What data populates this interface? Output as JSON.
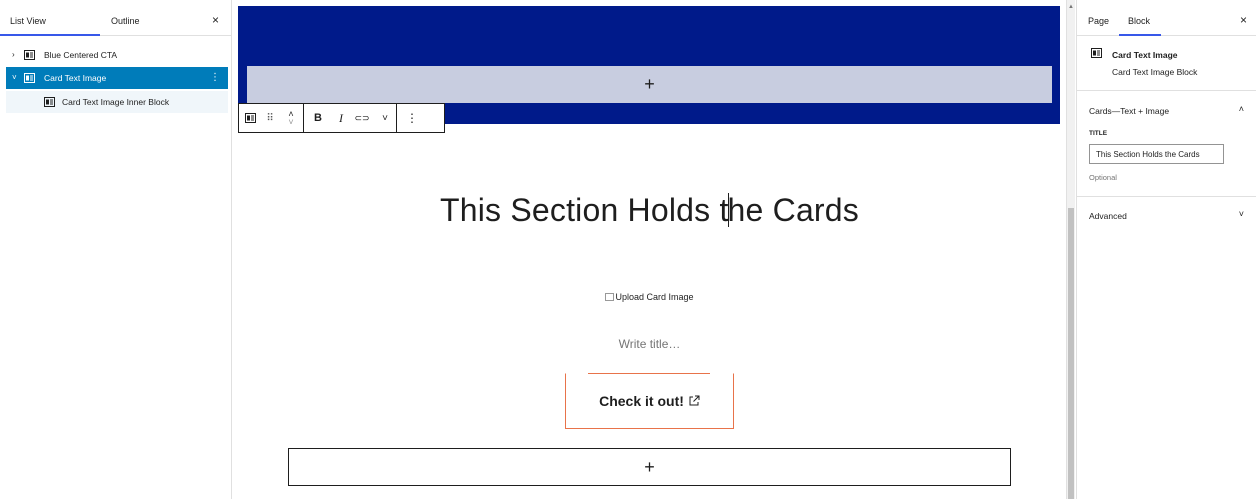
{
  "left_sidebar": {
    "tabs": {
      "list_view": "List View",
      "outline": "Outline"
    },
    "close_glyph": "×",
    "items": [
      {
        "label": "Blue Centered CTA",
        "chevron": "›"
      },
      {
        "label": "Card Text Image",
        "chevron": "˅",
        "options": "⋮"
      },
      {
        "label": "Card Text Image Inner Block"
      }
    ]
  },
  "canvas": {
    "top_inserter": "+",
    "heading_before": "This Section Holds t",
    "heading_after": "he Cards",
    "image_alt": "Upload Card Image",
    "title_placeholder": "Write title…",
    "button_label": "Check it out!",
    "button_icon": "↗",
    "bottom_inserter": "+"
  },
  "toolbar": {
    "drag": "⠿",
    "move_up": "˄",
    "move_down": "˅",
    "bold": "B",
    "italic": "I",
    "link": "⊂⊃",
    "more_rich": "˅",
    "options": "⋮"
  },
  "right_sidebar": {
    "tabs": {
      "page": "Page",
      "block": "Block"
    },
    "close_glyph": "×",
    "block_card": {
      "title": "Card Text Image",
      "description": "Card Text Image Block"
    },
    "panel": {
      "title": "Cards—Text + Image",
      "chevron": "˄",
      "field_label": "TITLE",
      "field_value": "This Section Holds the Cards",
      "field_help": "Optional"
    },
    "advanced": {
      "title": "Advanced",
      "chevron": "˅"
    }
  },
  "colors": {
    "accent": "#3858e9",
    "selected_row": "#007cba",
    "navy_band": "#001a8a",
    "button_border": "#e8734a"
  },
  "icons": [
    "block-icon",
    "close-icon",
    "chevron-icon",
    "drag-handle-icon",
    "link-icon",
    "external-link-icon",
    "kebab-menu-icon"
  ]
}
